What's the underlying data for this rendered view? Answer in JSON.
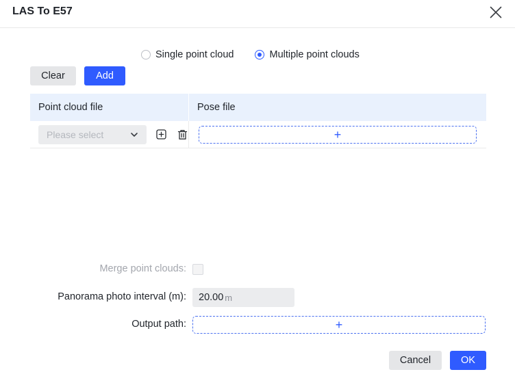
{
  "dialog": {
    "title": "LAS To E57"
  },
  "mode": {
    "options": [
      {
        "label": "Single point cloud",
        "checked": false
      },
      {
        "label": "Multiple point clouds",
        "checked": true
      }
    ]
  },
  "toolbar": {
    "clear_label": "Clear",
    "add_label": "Add"
  },
  "table": {
    "columns": [
      "Point cloud file",
      "Pose file"
    ],
    "rows": [
      {
        "select_placeholder": "Please select",
        "pose_add": "+"
      }
    ]
  },
  "form": {
    "merge_label": "Merge point clouds:",
    "merge_checked": false,
    "interval_label": "Panorama photo interval (m):",
    "interval_value": "20.00",
    "interval_unit": "m",
    "output_label": "Output path:",
    "output_add": "+"
  },
  "footer": {
    "cancel_label": "Cancel",
    "ok_label": "OK"
  },
  "colors": {
    "accent": "#2f5bff",
    "table_header_bg": "#e9f1fd",
    "gray_button": "#e5e6e8"
  }
}
